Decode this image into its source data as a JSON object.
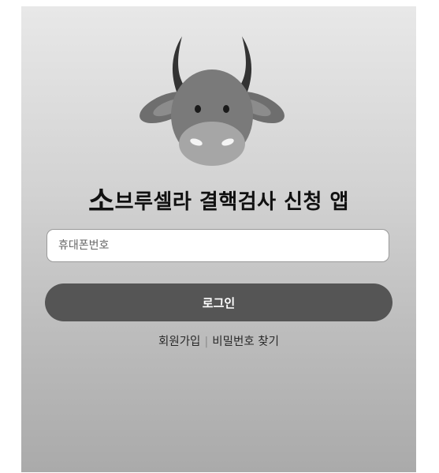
{
  "header": {
    "logo_icon": "cow-icon",
    "title_prefix": "소",
    "title_rest": "브루셀라 결핵검사 신청 앱"
  },
  "login_form": {
    "phone_placeholder": "휴대폰번호",
    "phone_value": "",
    "login_label": "로그인"
  },
  "footer_links": {
    "signup_label": "회원가입",
    "separator": "|",
    "find_password_label": "비밀번호 찾기"
  },
  "colors": {
    "button": "#555555",
    "input_background": "#ffffff",
    "screen_top": "#e8e8e8",
    "screen_bottom": "#aaaaaa"
  }
}
